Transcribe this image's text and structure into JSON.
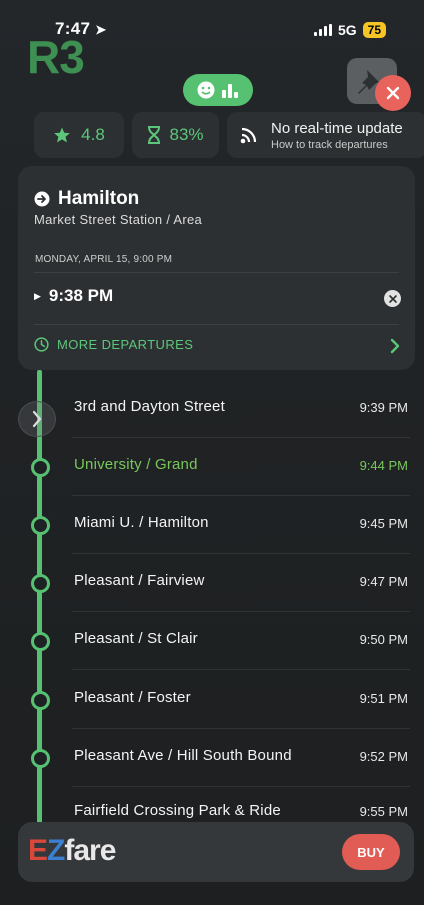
{
  "status_bar": {
    "time": "7:47",
    "network": "5G",
    "battery": "75"
  },
  "route": {
    "name": "R3"
  },
  "chips": {
    "rating": "4.8",
    "on_time": "83%",
    "realtime_title": "No real-time update",
    "realtime_sub": "How to track departures"
  },
  "card": {
    "destination": "Hamilton",
    "stop": "Market Street Station / Area",
    "date": "MONDAY, APRIL 15, 9:00 PM",
    "departure": "9:38 PM",
    "more": "MORE DEPARTURES"
  },
  "stops": [
    {
      "name": "3rd and Dayton Street",
      "time": "9:39 PM"
    },
    {
      "name": "University / Grand",
      "time": "9:44 PM"
    },
    {
      "name": "Miami U. / Hamilton",
      "time": "9:45 PM"
    },
    {
      "name": "Pleasant / Fairview",
      "time": "9:47 PM"
    },
    {
      "name": "Pleasant / St Clair",
      "time": "9:50 PM"
    },
    {
      "name": "Pleasant / Foster",
      "time": "9:51 PM"
    },
    {
      "name": "Pleasant Ave / Hill South Bound",
      "time": "9:52 PM"
    },
    {
      "name": "Fairfield Crossing Park & Ride",
      "time": "9:55 PM"
    }
  ],
  "ezfare": {
    "logo_e": "E",
    "logo_z": "Z",
    "logo_rest": "fare",
    "buy": "BUY"
  },
  "colors": {
    "accent": "#57c172",
    "close": "#e8635c",
    "buy": "#e25c56",
    "active_stop": "#79c85b"
  }
}
